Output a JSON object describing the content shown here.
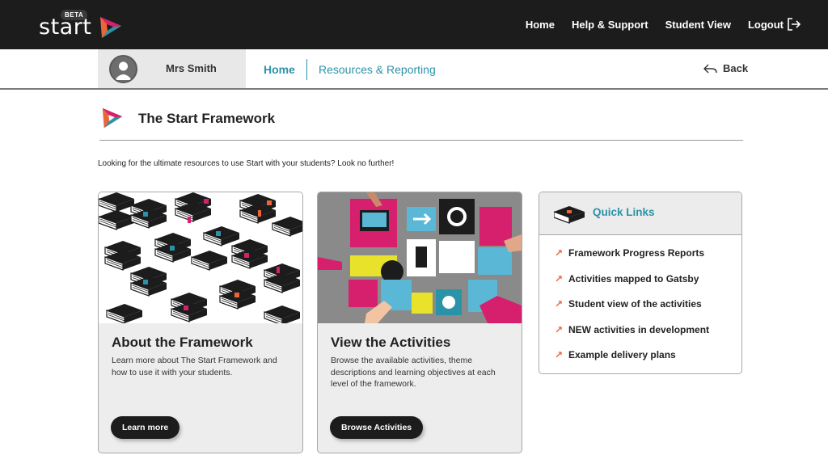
{
  "brand": {
    "name": "start",
    "badge": "BETA",
    "colors": {
      "teal": "#2b93a8",
      "orange": "#e8663a",
      "pink": "#d6206e",
      "dark": "#1c1c1c"
    }
  },
  "topnav": {
    "items": [
      "Home",
      "Help & Support",
      "Student View",
      "Logout"
    ],
    "logout_icon": "logout-icon"
  },
  "subnav": {
    "user_name": "Mrs Smith",
    "tabs": [
      "Home",
      "Resources & Reporting"
    ],
    "back_label": "Back"
  },
  "section": {
    "title": "The Start Framework",
    "intro": "Looking for the ultimate resources to use Start with your students? Look no further!"
  },
  "cards": [
    {
      "title": "About the Framework",
      "description": "Learn more about The Start Framework and how to use it with your students.",
      "button": "Learn more",
      "image": "books-pattern"
    },
    {
      "title": "View the Activities",
      "description": "Browse the available activities, theme descriptions and learning objectives at each level of the framework.",
      "button": "Browse Activities",
      "image": "hands-icons-tiles"
    }
  ],
  "quick_links": {
    "title": "Quick Links",
    "icon": "book-icon",
    "items": [
      "Framework Progress Reports",
      "Activities mapped to Gatsby",
      "Student view of the activities",
      "NEW activities in development",
      "Example delivery plans"
    ],
    "item_icon": "arrow-up-right-icon"
  }
}
